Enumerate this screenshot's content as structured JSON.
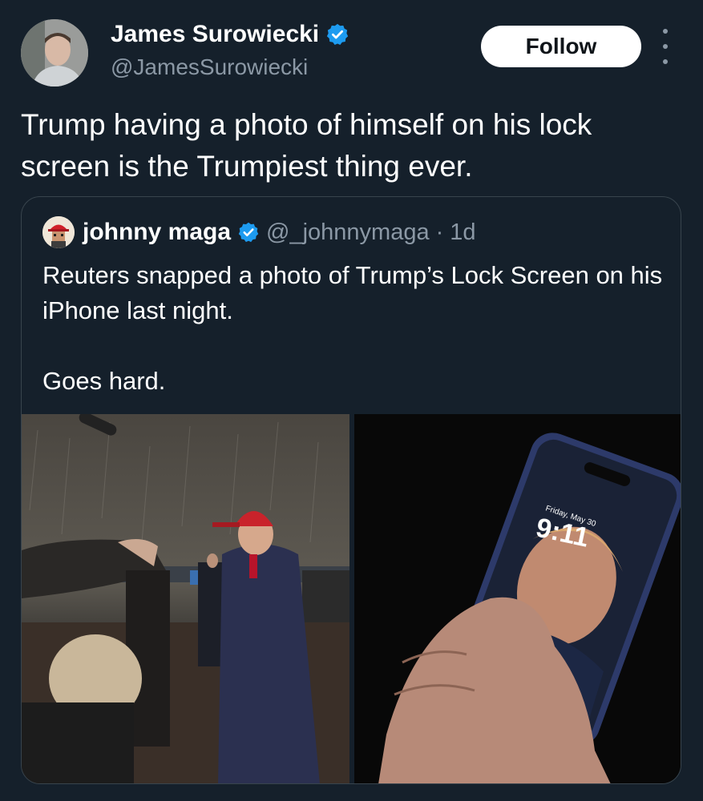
{
  "author": {
    "name": "James Surowiecki",
    "handle": "@JamesSurowiecki",
    "verified": true
  },
  "follow_label": "Follow",
  "tweet_text": "Trump having a photo of himself on his lock screen is the Trumpiest thing ever.",
  "quoted": {
    "name": "johnny maga",
    "handle": "@_johnnymaga",
    "separator": "·",
    "time": "1d",
    "verified": true,
    "text_line1": "Reuters snapped a photo of Trump’s Lock Screen on his iPhone last night.",
    "text_line2": "Goes hard.",
    "media": {
      "left_photo": "rainy-tarmac-photo",
      "right_photo": "phone-lock-screen-photo",
      "lock_date": "Friday, May 30",
      "lock_time": "9:11"
    }
  },
  "colors": {
    "background": "#15202b",
    "verified_blue": "#1d9bf0",
    "secondary_text": "#8b98a5",
    "card_border": "#38444d"
  }
}
